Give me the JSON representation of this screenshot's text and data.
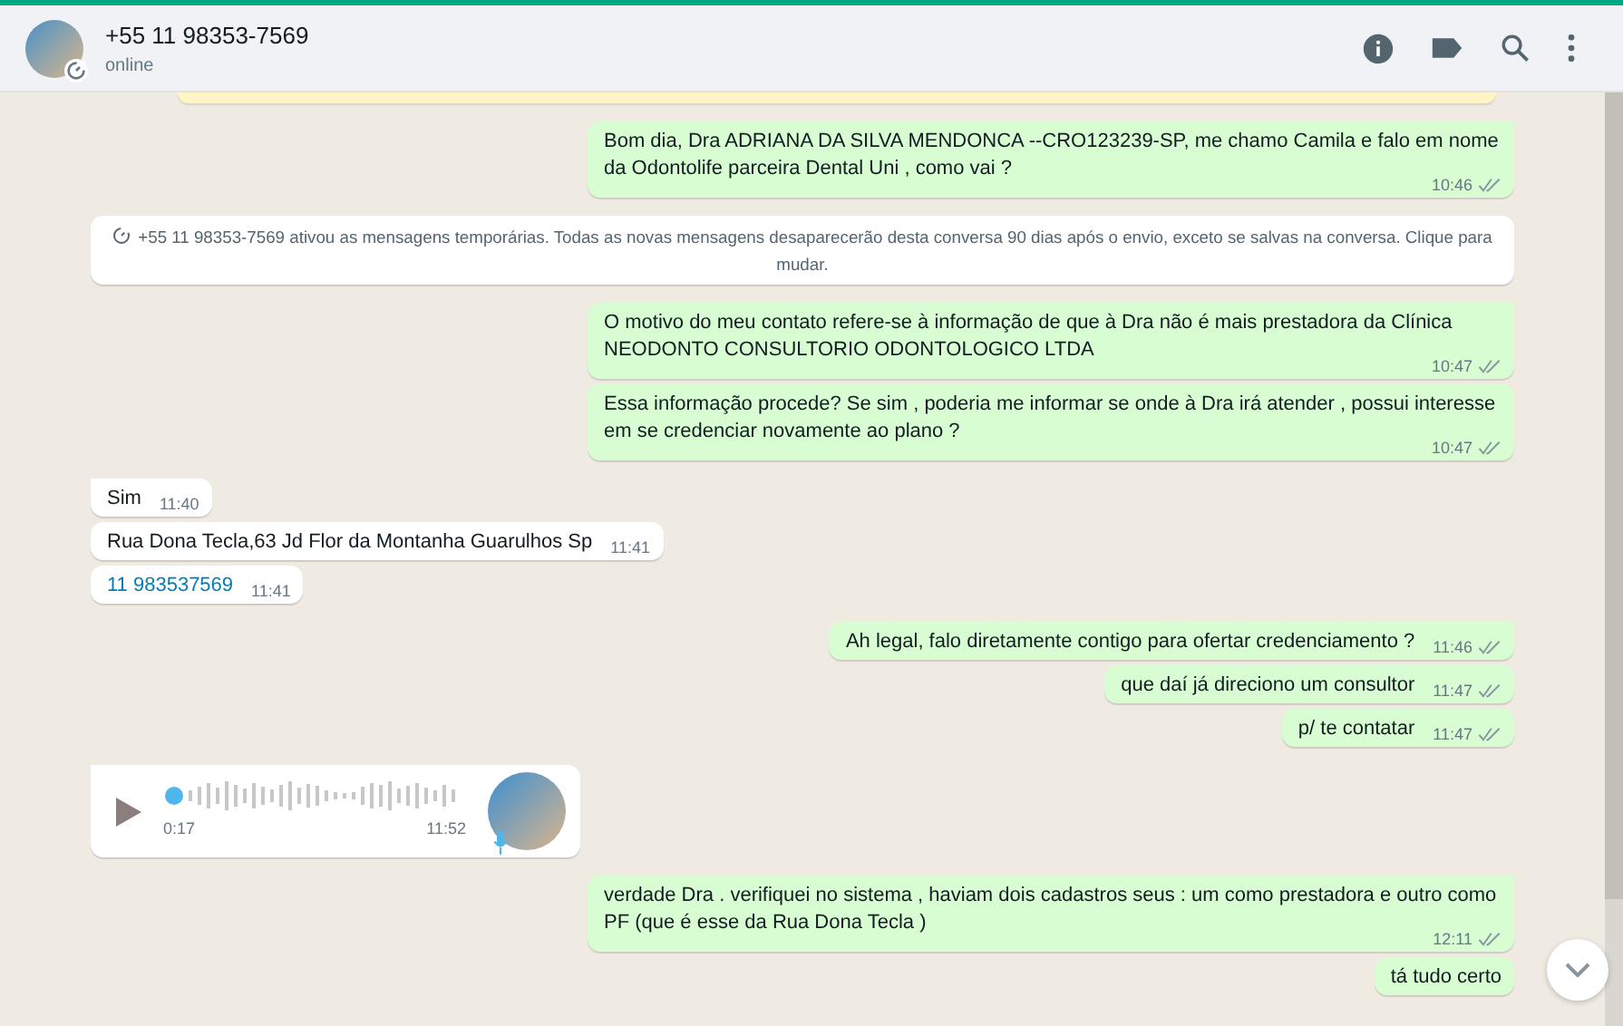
{
  "header": {
    "name": "+55 11 98353-7569",
    "status": "online"
  },
  "messages": [
    {
      "kind": "notice-edge"
    },
    {
      "kind": "out",
      "text": "Bom dia, Dra ADRIANA DA SILVA MENDONCA --CRO123239-SP, me chamo Camila e falo em nome da Odontolife parceira Dental Uni , como vai ?",
      "time": "10:46"
    },
    {
      "kind": "system",
      "text": "+55 11 98353-7569 ativou as mensagens temporárias. Todas as novas mensagens desaparecerão desta conversa 90 dias após o envio, exceto se salvas na conversa. Clique para mudar."
    },
    {
      "kind": "out",
      "text": "O motivo do meu contato refere-se à informação de que à Dra não é mais prestadora da Clínica NEODONTO CONSULTORIO ODONTOLOGICO LTDA",
      "time": "10:47"
    },
    {
      "kind": "out",
      "text": "Essa informação procede? Se sim , poderia me informar se onde à Dra irá atender , possui interesse em se credenciar novamente ao plano ?",
      "time": "10:47"
    },
    {
      "kind": "in",
      "text": "Sim",
      "time": "11:40"
    },
    {
      "kind": "in",
      "text": "Rua Dona Tecla,63 Jd Flor da Montanha Guarulhos Sp",
      "time": "11:41"
    },
    {
      "kind": "in-link",
      "text": "11 983537569",
      "time": "11:41"
    },
    {
      "kind": "out",
      "text": "Ah legal, falo diretamente contigo para ofertar credenciamento ?",
      "time": "11:46"
    },
    {
      "kind": "out",
      "text": "que daí já direciono um consultor",
      "time": "11:47"
    },
    {
      "kind": "out",
      "text": "p/ te contatar",
      "time": "11:47"
    },
    {
      "kind": "audio",
      "duration": "0:17",
      "time": "11:52",
      "level": 0.02
    },
    {
      "kind": "out",
      "text": "verdade Dra . verifiquei no sistema , haviam dois cadastros seus : um como prestadora e outro como PF (que é esse da Rua Dona Tecla )",
      "time": "12:11"
    },
    {
      "kind": "out",
      "text": "tá tudo certo"
    }
  ]
}
